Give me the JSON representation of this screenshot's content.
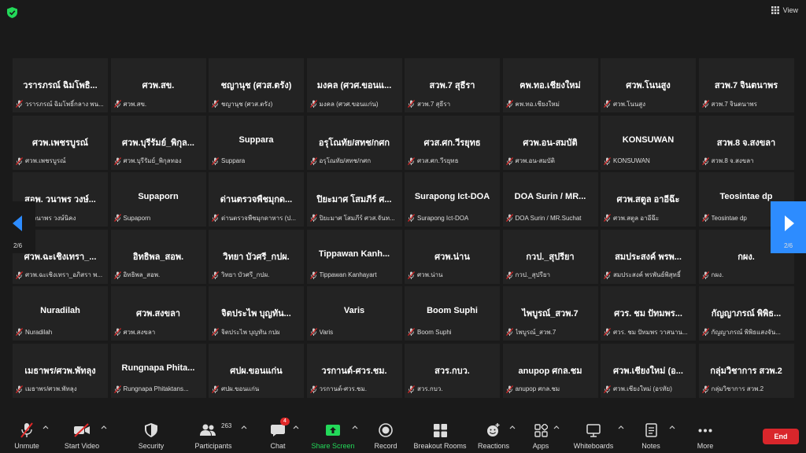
{
  "header": {
    "view_label": "View"
  },
  "pager": {
    "left_page": "2/6",
    "right_page": "2/6"
  },
  "participants": [
    {
      "display": "วรารภรณ์ ฉิมโพธิ...",
      "sub": "วรารภรณ์ ฉิมโพธิ์กลาง พน..."
    },
    {
      "display": "ศวพ.สข.",
      "sub": "ศวพ.สข."
    },
    {
      "display": "ชญานุช (ศวส.ตรัง)",
      "sub": "ชญานุช (ศวส.ตรัง)"
    },
    {
      "display": "มงคล (ศวศ.ขอนแ...",
      "sub": "มงคล (ศวศ.ขอนแก่น)"
    },
    {
      "display": "สวพ.7 สุธีรา",
      "sub": "สวพ.7 สุธีรา"
    },
    {
      "display": "ฅพ.ทอ.เชียงใหม่",
      "sub": "ฅพ.ทอ.เชียงใหม่"
    },
    {
      "display": "ศวพ.โนนสูง",
      "sub": "ศวพ.โนนสูง"
    },
    {
      "display": "สวพ.7 จินตนาพร",
      "sub": "สวพ.7 จินตนาพร"
    },
    {
      "display": "ศวพ.เพชรบูรณ์",
      "sub": "ศวพ.เพชรบูรณ์"
    },
    {
      "display": "ศวพ.บุรีรัมย์_พิกุล...",
      "sub": "ศวพ.บุรีรัมย์_พิกุลทอง"
    },
    {
      "display": "Suppara",
      "sub": "Suppara"
    },
    {
      "display": "อรุโณทัย/สทช/กศก",
      "sub": "อรุโณทัย/สทช/กศก"
    },
    {
      "display": "ศวส.ศก.วีรยุทธ",
      "sub": "ศวส.ศก.วีรยุทธ"
    },
    {
      "display": "ศวพ.อน-สมบัติ",
      "sub": "ศวพ.อน-สมบัติ"
    },
    {
      "display": "KONSUWAN",
      "sub": "KONSUWAN"
    },
    {
      "display": "สวพ.8 จ.สงขลา",
      "sub": "สวพ.8 จ.สงขลา"
    },
    {
      "display": "สอพ. วนาพร วงษ์...",
      "sub": "พ. วนาพร วงษ์นิคง"
    },
    {
      "display": "Supaporn",
      "sub": "Supaporn"
    },
    {
      "display": "ด่านตรวจพืชมุกด...",
      "sub": "ด่านตรวจพืชมุกดาหาร (ป..."
    },
    {
      "display": "ปิยะมาศ โสมภีร์ ศ...",
      "sub": "ปิยะมาศ โสมภีร์ ศวส.จันท..."
    },
    {
      "display": "Surapong Ict-DOA",
      "sub": "Surapong Ict-DOA"
    },
    {
      "display": "DOA Surin / MR...",
      "sub": "DOA Surin / MR.Suchat"
    },
    {
      "display": "ศวพ.สตูล อาอีฉ๊ะ",
      "sub": "ศวพ.สตูล อาอีฉ๊ะ"
    },
    {
      "display": "Teosintae dp",
      "sub": "Teosintae dp"
    },
    {
      "display": "ศวพ.ฉะเชิงเทรา_...",
      "sub": "ศวพ.ฉะเชิงเทรา_อภิสรา พ..."
    },
    {
      "display": "อิทธิพล_สอพ.",
      "sub": "อิทธิพล_สอพ."
    },
    {
      "display": "วิทยา บัวศรี_กปผ.",
      "sub": "วิทยา บัวศรี_กปผ."
    },
    {
      "display": "Tippawan  Kanh...",
      "sub": "Tippawan Kanhayart"
    },
    {
      "display": "ศวพ.น่าน",
      "sub": "ศวพ.น่าน"
    },
    {
      "display": "กวป._สุปรียา",
      "sub": "กวป._สุปรียา"
    },
    {
      "display": "สมประสงค์ พรพ...",
      "sub": "สมประสงค์ พรพันธ์พิสุทธิ์"
    },
    {
      "display": "กผง.",
      "sub": "กผง."
    },
    {
      "display": "Nuradilah",
      "sub": "Nuradilah"
    },
    {
      "display": "ศวพ.สงขลา",
      "sub": "ศวพ.สงขลา"
    },
    {
      "display": "จิตประไพ บุญทัน...",
      "sub": "จิตประไพ บุญทัน กปผ"
    },
    {
      "display": "Varis",
      "sub": "Varis"
    },
    {
      "display": "Boom Suphi",
      "sub": "Boom Suphi"
    },
    {
      "display": "ไพบูรณ์_สวพ.7",
      "sub": "ไพบูรณ์_สวพ.7"
    },
    {
      "display": "ศวร. ชม ปัทมพร...",
      "sub": "ศวร. ชม ปัทมพร วาสนาน..."
    },
    {
      "display": "กัญญาภรณ์ พิพิธ...",
      "sub": "กัญญาภรณ์ พิพิธแสงจัน..."
    },
    {
      "display": "เมธาพร/ศวพ.พัทลุง",
      "sub": "เมธาพร/ศวพ.พัทลุง"
    },
    {
      "display": "Rungnapa  Phita...",
      "sub": "Rungnapa Phitaktans..."
    },
    {
      "display": "ศปผ.ขอนแก่น",
      "sub": "ศปผ.ขอนแก่น"
    },
    {
      "display": "วรกานต์-ศวร.ชม.",
      "sub": "วรกานต์-ศวร.ชม."
    },
    {
      "display": "สวร.กบว.",
      "sub": "สวร.กบว."
    },
    {
      "display": "anupop ศกล.ชม",
      "sub": "anupop ศกล.ชม"
    },
    {
      "display": "ศวพ.เชียงใหม่ (อ...",
      "sub": "ศวพ.เชียงใหม่ (อรทัย)"
    },
    {
      "display": "กลุ่มวิชาการ สวพ.2",
      "sub": "กลุ่มวิชาการ สวพ.2"
    }
  ],
  "toolbar": {
    "unmute": "Unmute",
    "start_video": "Start Video",
    "security": "Security",
    "participants": "Participants",
    "participants_count": "263",
    "chat": "Chat",
    "chat_badge": "4",
    "share_screen": "Share Screen",
    "record": "Record",
    "breakout": "Breakout Rooms",
    "reactions": "Reactions",
    "apps": "Apps",
    "whiteboards": "Whiteboards",
    "notes": "Notes",
    "more": "More",
    "end": "End"
  },
  "colors": {
    "accent": "#2d8cff",
    "end": "#d9262b",
    "share": "#23d959",
    "muted": "#e02828"
  },
  "icons": [
    "shield-check-icon",
    "view-grid-icon",
    "mic-muted-icon",
    "video-off-icon",
    "security-icon",
    "participants-icon",
    "chat-icon",
    "share-screen-icon",
    "record-icon",
    "breakout-icon",
    "reactions-icon",
    "apps-icon",
    "whiteboards-icon",
    "notes-icon",
    "more-icon",
    "arrow-left-icon",
    "arrow-right-icon"
  ]
}
